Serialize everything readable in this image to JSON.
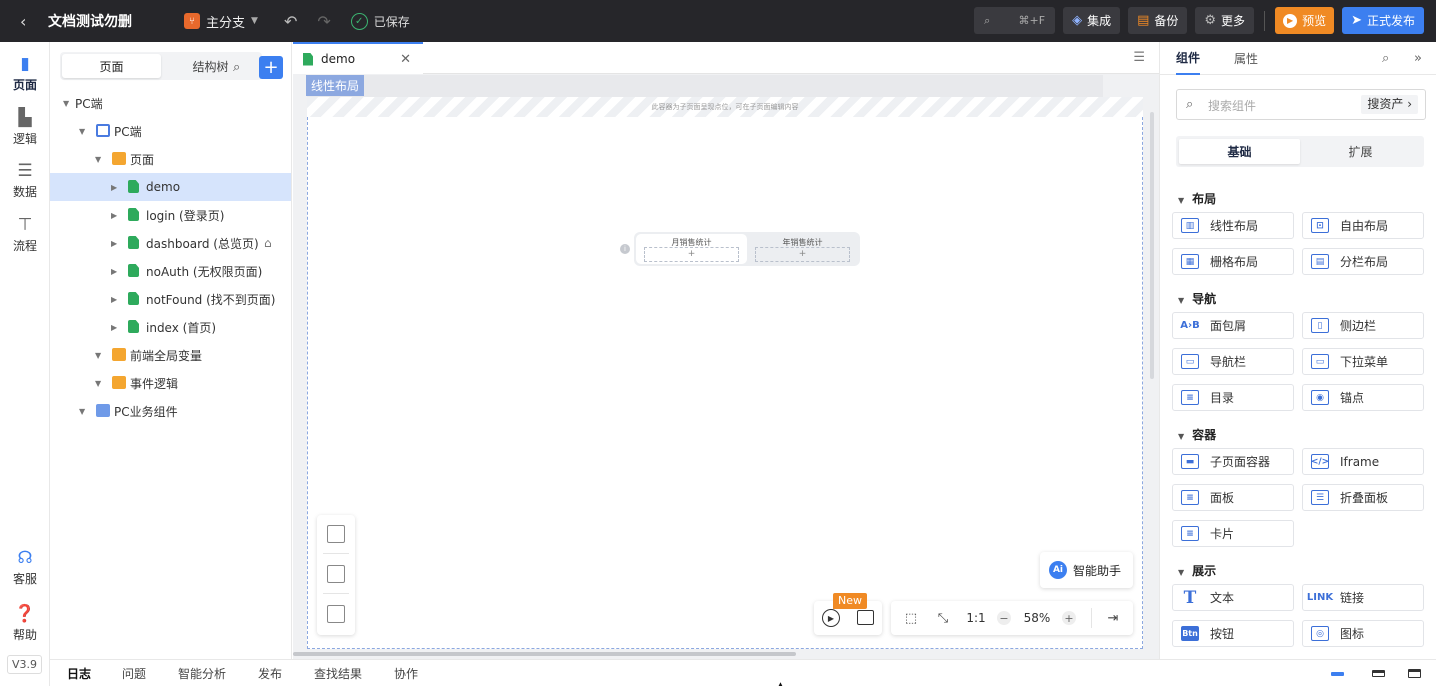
{
  "topbar": {
    "title": "文档测试勿删",
    "branch": "主分支",
    "saved": "已保存",
    "search_shortcut": "⌘+F",
    "integrate": "集成",
    "backup": "备份",
    "more": "更多",
    "preview": "预览",
    "publish": "正式发布"
  },
  "rail": {
    "items": [
      {
        "label": "页面",
        "icon": "page-icon"
      },
      {
        "label": "逻辑",
        "icon": "logic-icon"
      },
      {
        "label": "数据",
        "icon": "database-icon"
      },
      {
        "label": "流程",
        "icon": "flow-icon"
      }
    ],
    "service": "客服",
    "help": "帮助",
    "version": "V3.9"
  },
  "tree": {
    "tabs": [
      "页面",
      "结构树"
    ],
    "rows": [
      {
        "label": "PC端",
        "level": 0,
        "icon": "none"
      },
      {
        "label": "PC端",
        "level": 1,
        "icon": "monitor"
      },
      {
        "label": "页面",
        "level": 2,
        "icon": "folder"
      },
      {
        "label": "demo",
        "level": 3,
        "icon": "page"
      },
      {
        "label": "login (登录页)",
        "level": 3,
        "icon": "page"
      },
      {
        "label": "dashboard (总览页)",
        "level": 3,
        "icon": "page"
      },
      {
        "label": "noAuth (无权限页面)",
        "level": 3,
        "icon": "page"
      },
      {
        "label": "notFound (找不到页面)",
        "level": 3,
        "icon": "page"
      },
      {
        "label": "index (首页)",
        "level": 3,
        "icon": "page"
      },
      {
        "label": "前端全局变量",
        "level": 2,
        "icon": "folder"
      },
      {
        "label": "事件逻辑",
        "level": 2,
        "icon": "folder"
      },
      {
        "label": "PC业务组件",
        "level": 1,
        "icon": "puzzle"
      }
    ]
  },
  "editor": {
    "tab": "demo",
    "layout_tag": "线性布局",
    "container_hint": "此容器为子页面呈现点位，可在子页面编辑内容",
    "widget_tabs": [
      "月销售统计",
      "年销售统计"
    ],
    "widget_plus": "+",
    "ai_badge": "Ai",
    "ai_label": "智能助手",
    "new_badge": "New",
    "ratio": "1:1",
    "zoom": "58%",
    "zoom_minus": "−",
    "zoom_plus": "+"
  },
  "right": {
    "tabs": [
      "组件",
      "属性"
    ],
    "search_placeholder": "搜索组件",
    "assets": "搜资产",
    "segments": [
      "基础",
      "扩展"
    ],
    "groups": [
      {
        "label": "布局",
        "items": [
          {
            "label": "线性布局",
            "icon": "linear-layout-icon"
          },
          {
            "label": "自由布局",
            "icon": "free-layout-icon"
          },
          {
            "label": "栅格布局",
            "icon": "grid-layout-icon"
          },
          {
            "label": "分栏布局",
            "icon": "column-layout-icon"
          }
        ]
      },
      {
        "label": "导航",
        "items": [
          {
            "label": "面包屑",
            "icon": "breadcrumb-icon",
            "glyph": "A›B"
          },
          {
            "label": "侧边栏",
            "icon": "sidebar-icon"
          },
          {
            "label": "导航栏",
            "icon": "navbar-icon"
          },
          {
            "label": "下拉菜单",
            "icon": "dropdown-icon"
          },
          {
            "label": "目录",
            "icon": "toc-icon"
          },
          {
            "label": "锚点",
            "icon": "anchor-icon"
          }
        ]
      },
      {
        "label": "容器",
        "items": [
          {
            "label": "子页面容器",
            "icon": "subpage-container-icon"
          },
          {
            "label": "Iframe",
            "icon": "iframe-icon",
            "glyph": "</>"
          },
          {
            "label": "面板",
            "icon": "panel-icon"
          },
          {
            "label": "折叠面板",
            "icon": "collapse-panel-icon"
          },
          {
            "label": "卡片",
            "icon": "card-icon"
          }
        ]
      },
      {
        "label": "展示",
        "items": [
          {
            "label": "文本",
            "icon": "text-icon",
            "glyph": "T"
          },
          {
            "label": "链接",
            "icon": "link-icon",
            "glyph": "LINK"
          },
          {
            "label": "按钮",
            "icon": "button-icon",
            "glyph": "Btn"
          },
          {
            "label": "图标",
            "icon": "image-icon"
          }
        ]
      }
    ]
  },
  "bottom": {
    "tabs": [
      "日志",
      "问题",
      "智能分析",
      "发布",
      "查找结果",
      "协作"
    ]
  },
  "colors": {
    "accent": "#3c7ff0",
    "topbar": "#26262a",
    "preview": "#f08a24",
    "selected_row": "#d6e4fc"
  }
}
